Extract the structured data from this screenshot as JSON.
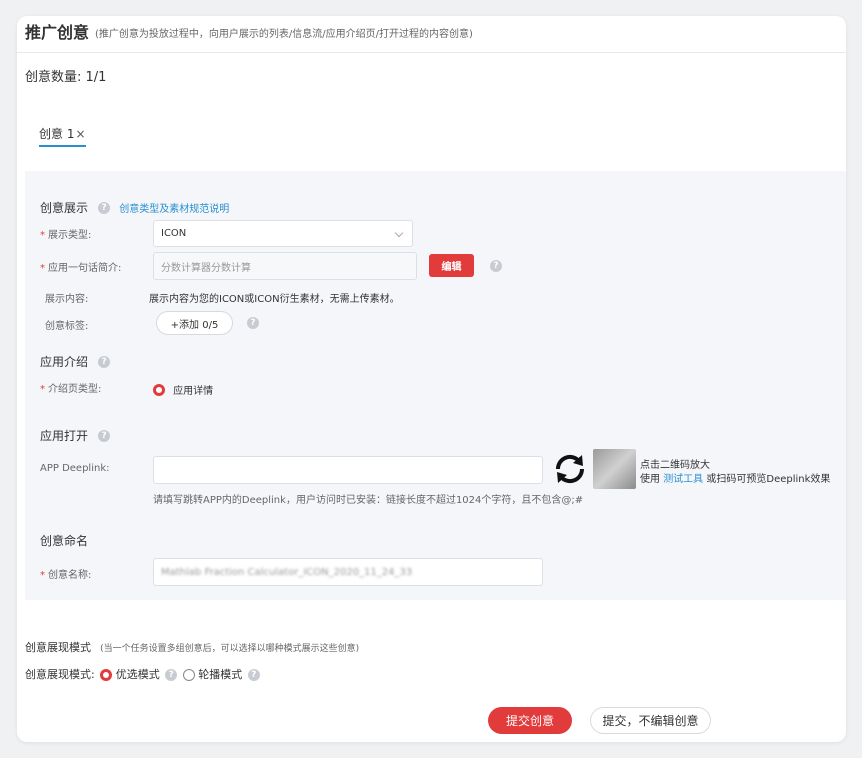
{
  "header": {
    "title": "推广创意",
    "desc": "(推广创意为投放过程中，向用户展示的列表/信息流/应用介绍页/打开过程的内容创意)"
  },
  "count_label": "创意数量: 1/1",
  "tab": {
    "label": "创意 1",
    "close": "×"
  },
  "display": {
    "title": "创意展示",
    "spec_link": "创意类型及素材规范说明",
    "type_label": "展示类型:",
    "type_value": "ICON",
    "intro_label": "应用一句话简介:",
    "intro_value": "分数计算器分数计算",
    "edit_button": "编辑",
    "content_label": "展示内容:",
    "content_value": "展示内容为您的ICON或ICON衍生素材，无需上传素材。",
    "tags_label": "创意标签:",
    "tags_button": "+添加 0/5"
  },
  "intro": {
    "title": "应用介绍",
    "page_type_label": "介绍页类型:",
    "page_type_value": "应用详情"
  },
  "open": {
    "title": "应用打开",
    "deeplink_label": "APP Deeplink:",
    "deeplink_value": "",
    "qr_hint1": "点击二维码放大",
    "qr_hint2_prefix": "使用",
    "qr_hint2_link": "测试工具",
    "qr_hint2_suffix": "或扫码可预览Deeplink效果",
    "help": "请填写跳转APP内的Deeplink，用户访问时已安装：链接长度不超过1024个字符，且不包含@;#"
  },
  "naming": {
    "title": "创意命名",
    "name_label": "创意名称:",
    "name_value": "Mathlab Fraction Calculator_ICON_2020_11_24_33"
  },
  "mode": {
    "title": "创意展现模式",
    "title_desc": "(当一个任务设置多组创意后，可以选择以哪种模式展示这些创意)",
    "label": "创意展现模式:",
    "option1": "优选模式",
    "option2": "轮播模式"
  },
  "footer": {
    "submit": "提交创意",
    "submit_no_edit": "提交，不编辑创意"
  },
  "colors": {
    "accent": "#e23b3b",
    "link": "#2a8fd0"
  }
}
